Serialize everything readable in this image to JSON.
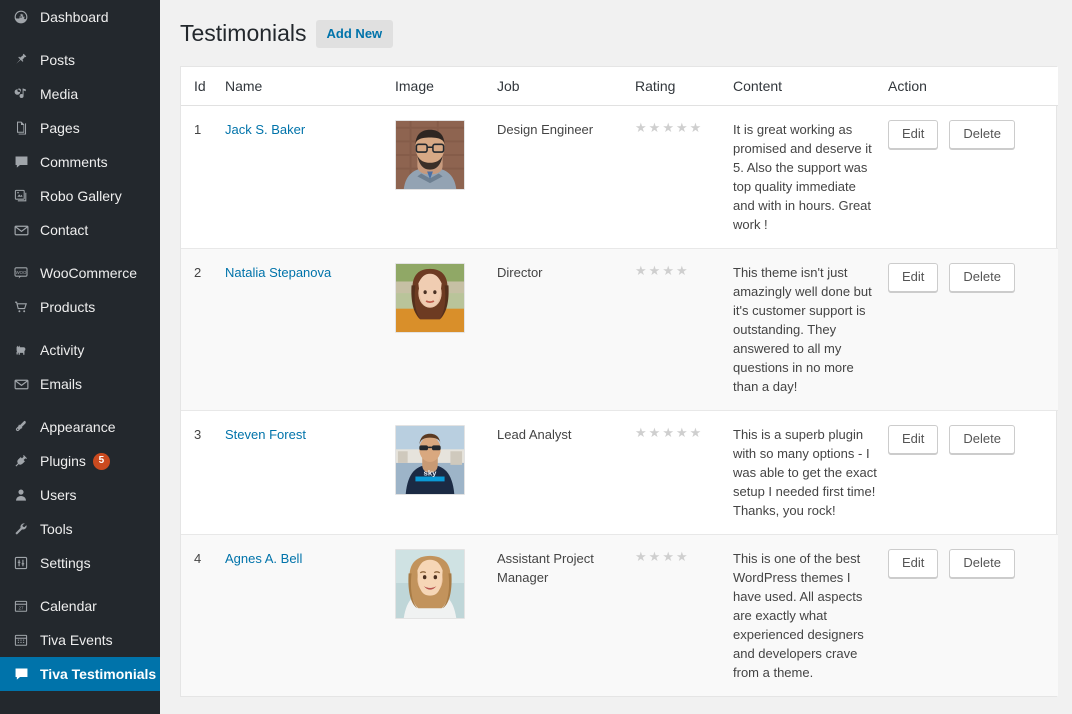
{
  "sidebar": {
    "groups": [
      {
        "items": [
          {
            "label": "Dashboard",
            "icon": "dashboard-icon",
            "active": false
          }
        ]
      },
      {
        "items": [
          {
            "label": "Posts",
            "icon": "pin-icon",
            "active": false
          },
          {
            "label": "Media",
            "icon": "media-icon",
            "active": false
          },
          {
            "label": "Pages",
            "icon": "pages-icon",
            "active": false
          },
          {
            "label": "Comments",
            "icon": "comment-icon",
            "active": false
          },
          {
            "label": "Robo Gallery",
            "icon": "gallery-icon",
            "active": false
          },
          {
            "label": "Contact",
            "icon": "envelope-icon",
            "active": false
          }
        ]
      },
      {
        "items": [
          {
            "label": "WooCommerce",
            "icon": "woo-icon",
            "active": false
          },
          {
            "label": "Products",
            "icon": "cart-icon",
            "active": false
          }
        ]
      },
      {
        "items": [
          {
            "label": "Activity",
            "icon": "activity-icon",
            "active": false
          },
          {
            "label": "Emails",
            "icon": "envelope-icon",
            "active": false
          }
        ]
      },
      {
        "items": [
          {
            "label": "Appearance",
            "icon": "brush-icon",
            "active": false
          },
          {
            "label": "Plugins",
            "icon": "plug-icon",
            "active": false,
            "badge": "5"
          },
          {
            "label": "Users",
            "icon": "user-icon",
            "active": false
          },
          {
            "label": "Tools",
            "icon": "wrench-icon",
            "active": false
          },
          {
            "label": "Settings",
            "icon": "sliders-icon",
            "active": false
          }
        ]
      },
      {
        "items": [
          {
            "label": "Calendar",
            "icon": "calendar-icon",
            "active": false
          },
          {
            "label": "Tiva Events",
            "icon": "calendar-alt-icon",
            "active": false
          },
          {
            "label": "Tiva Testimonials",
            "icon": "comment-icon",
            "active": true
          }
        ]
      }
    ]
  },
  "page": {
    "title": "Testimonials",
    "add_new_label": "Add New"
  },
  "table": {
    "columns": [
      "Id",
      "Name",
      "Image",
      "Job",
      "Rating",
      "Content",
      "Action"
    ],
    "edit_label": "Edit",
    "delete_label": "Delete",
    "star_glyph": "★",
    "star_color": "#cfcfcf",
    "rows": [
      {
        "id": "1",
        "name": "Jack S. Baker",
        "job": "Design Engineer",
        "rating": 5,
        "content": "It is great working as promised and deserve it 5. Also the support was top quality immediate and with in hours. Great work !",
        "image": "portrait-man-glasses-beard"
      },
      {
        "id": "2",
        "name": "Natalia Stepanova",
        "job": "Director",
        "rating": 4,
        "content": "This theme isn't just amazingly well done but it's customer support is outstanding. They answered to all my questions in no more than a day!",
        "image": "portrait-woman-long-hair"
      },
      {
        "id": "3",
        "name": "Steven Forest",
        "job": "Lead Analyst",
        "rating": 5,
        "content": "This is a superb plugin with so many options - I was able to get the exact setup I needed first time! Thanks, you rock!",
        "image": "portrait-man-sunglasses-jersey"
      },
      {
        "id": "4",
        "name": "Agnes A. Bell",
        "job": "Assistant Project Manager",
        "rating": 4,
        "content": "This is one of the best WordPress themes I have used. All aspects are exactly what experienced designers and developers crave from a theme.",
        "image": "portrait-woman-smiling-blonde"
      }
    ]
  },
  "colors": {
    "sidebar_bg": "#23282d",
    "accent": "#0073aa",
    "badge": "#ca4a1f",
    "page_bg": "#f1f1f1"
  }
}
